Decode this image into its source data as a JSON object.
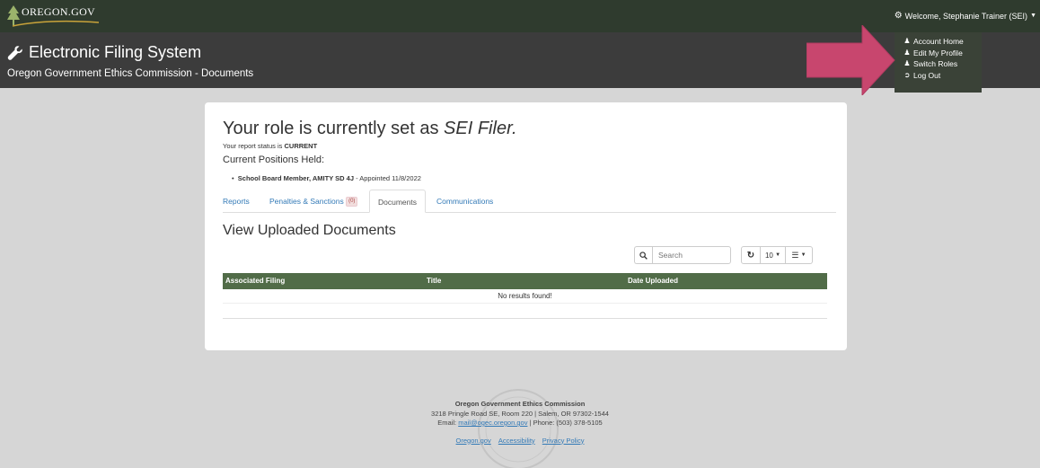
{
  "topbar": {
    "logo_text": "OREGON.GOV",
    "welcome": "Welcome, Stephanie Trainer (SEI)"
  },
  "banner": {
    "title": "Electronic Filing System",
    "subtitle": "Oregon Government Ethics Commission - Documents"
  },
  "dropdown": {
    "items": [
      {
        "label": "Account Home",
        "icon": "user-icon"
      },
      {
        "label": "Edit My Profile",
        "icon": "user-icon"
      },
      {
        "label": "Switch Roles",
        "icon": "users-icon"
      },
      {
        "label": "Log Out",
        "icon": "sign-out-icon"
      }
    ]
  },
  "card": {
    "role_prefix": "Your role is currently set as ",
    "role_name": "SEI Filer.",
    "status_prefix": "Your report status is ",
    "status_value": "CURRENT",
    "positions_heading": "Current Positions Held:",
    "position_name": "School Board Member, AMITY SD 4J",
    "position_detail": " - Appointed 11/8/2022",
    "tabs": [
      {
        "label": "Reports"
      },
      {
        "label": "Penalties & Sanctions",
        "badge": "(0)"
      },
      {
        "label": "Documents"
      },
      {
        "label": "Communications"
      }
    ],
    "section_title": "View Uploaded Documents",
    "search_placeholder": "Search",
    "page_size": "10",
    "table": {
      "columns": [
        "Associated Filing",
        "Title",
        "Date Uploaded"
      ],
      "empty_message": "No results found!"
    }
  },
  "footer": {
    "org": "Oregon Government Ethics Commission",
    "address": "3218 Pringle Road SE, Room 220 | Salem, OR 97302-1544",
    "email_prefix": "Email: ",
    "email": "mail@ogec.oregon.gov",
    "phone": " | Phone: (503) 378-5105",
    "links": [
      "Oregon.gov",
      "Accessibility",
      "Privacy Policy"
    ]
  },
  "colors": {
    "topbar": "#2f3b2e",
    "banner": "#3c3c3c",
    "table_header": "#516c48",
    "arrow": "#c8466e",
    "link": "#337ab7"
  }
}
